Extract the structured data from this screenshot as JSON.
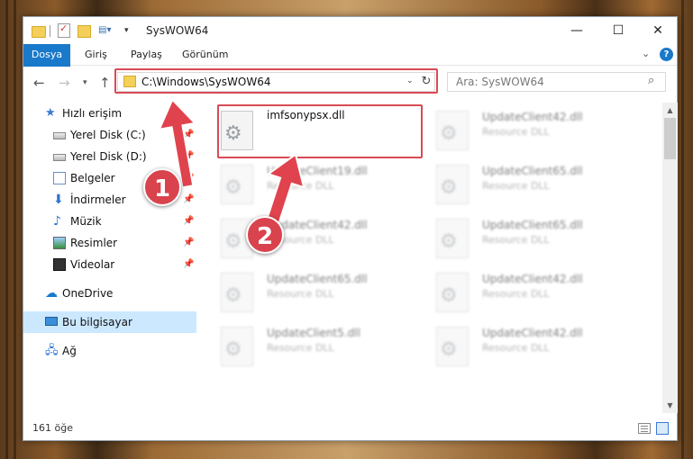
{
  "window": {
    "title": "SysWOW64",
    "minimize_glyph": "—",
    "maximize_glyph": "☐",
    "close_glyph": "✕"
  },
  "ribbon": {
    "tabs": [
      {
        "label": "Dosya"
      },
      {
        "label": "Giriş"
      },
      {
        "label": "Paylaş"
      },
      {
        "label": "Görünüm"
      }
    ],
    "help_glyph": "?"
  },
  "nav": {
    "address": "C:\\Windows\\SysWOW64",
    "search_placeholder": "Ara: SysWOW64"
  },
  "sidebar": {
    "items": [
      {
        "label": "Hızlı erişim",
        "icon": "star-icon"
      },
      {
        "label": "Yerel Disk (C:)",
        "icon": "drive-icon",
        "pinned": true
      },
      {
        "label": "Yerel Disk (D:)",
        "icon": "drive-icon",
        "pinned": true
      },
      {
        "label": "Belgeler",
        "icon": "documents-icon",
        "pinned": true
      },
      {
        "label": "İndirmeler",
        "icon": "download-icon",
        "pinned": true
      },
      {
        "label": "Müzik",
        "icon": "music-icon",
        "pinned": true
      },
      {
        "label": "Resimler",
        "icon": "pictures-icon",
        "pinned": true
      },
      {
        "label": "Videolar",
        "icon": "video-icon",
        "pinned": true
      },
      {
        "label": "OneDrive",
        "icon": "cloud-icon"
      },
      {
        "label": "Bu bilgisayar",
        "icon": "computer-icon",
        "selected": true
      },
      {
        "label": "Ağ",
        "icon": "network-icon"
      }
    ]
  },
  "files": {
    "highlighted": {
      "name": "imfsonypsx.dll"
    },
    "blurred": [
      {
        "name": "UpdateClient42.dll",
        "desc": "Resource DLL"
      },
      {
        "name": "UpdateClient19.dll",
        "desc": "Resource DLL"
      },
      {
        "name": "UpdateClient65.dll",
        "desc": "Resource DLL"
      },
      {
        "name": "UpdateClient42.dll",
        "desc": "Resource DLL"
      },
      {
        "name": "UpdateClient65.dll",
        "desc": "Resource DLL"
      },
      {
        "name": "UpdateClient65.dll",
        "desc": "Resource DLL"
      },
      {
        "name": "UpdateClient42.dll",
        "desc": "Resource DLL"
      },
      {
        "name": "UpdateClient5.dll",
        "desc": "Resource DLL"
      },
      {
        "name": "UpdateClient42.dll",
        "desc": "Resource DLL"
      }
    ]
  },
  "status": {
    "count": "161 öğe"
  },
  "annotations": {
    "step1": "1",
    "step2": "2",
    "highlight_color": "#d94b55"
  }
}
